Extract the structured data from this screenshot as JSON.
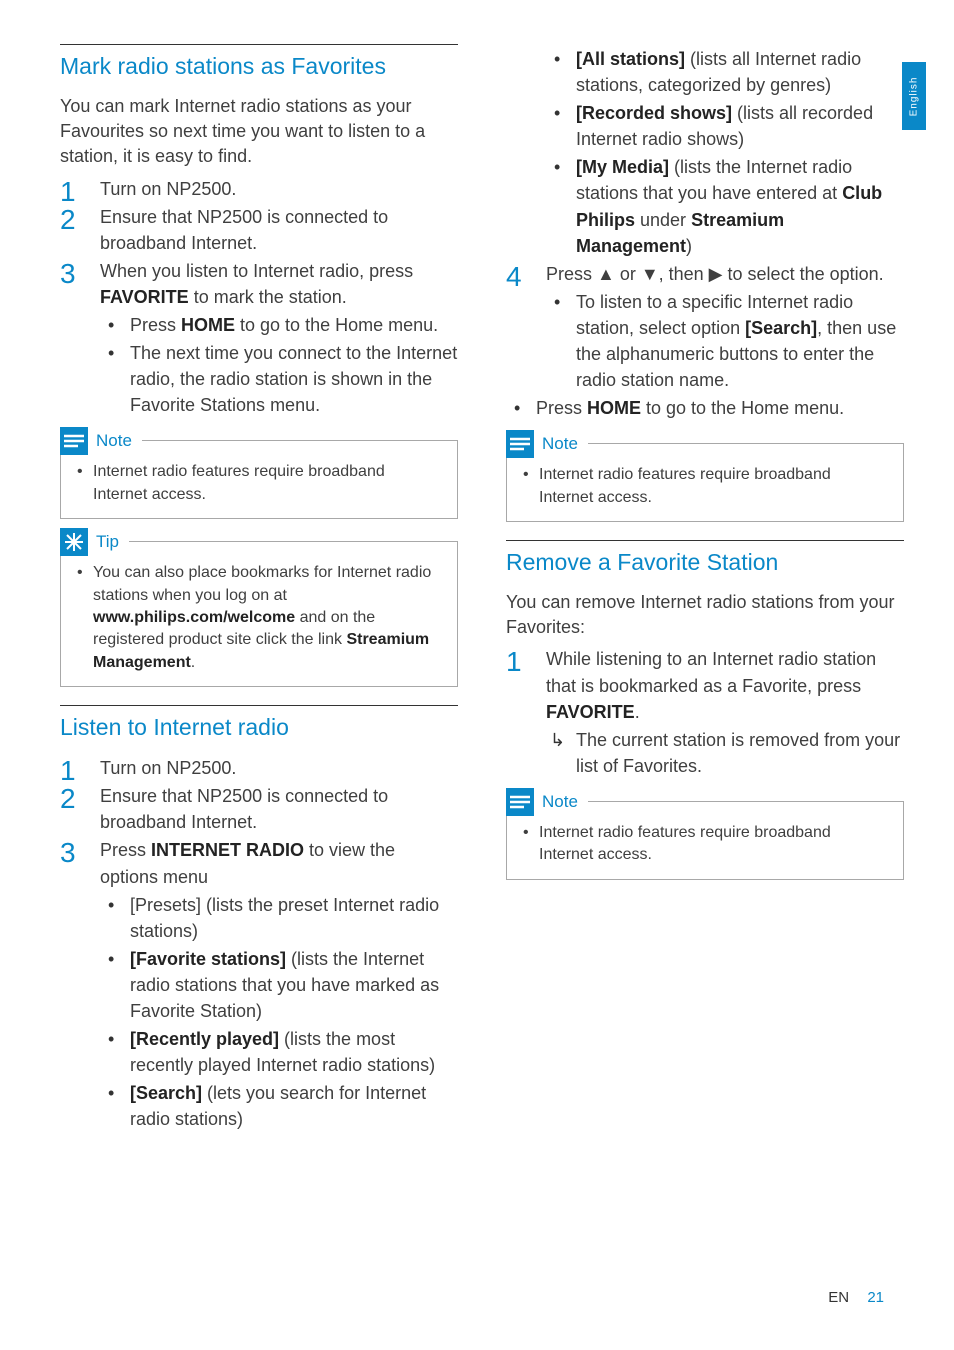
{
  "sideTab": "English",
  "footer": {
    "lang": "EN",
    "page": "21"
  },
  "labels": {
    "note": "Note",
    "tip": "Tip"
  },
  "left": {
    "sec1": {
      "title": "Mark radio stations as Favorites",
      "intro": "You can mark Internet radio stations as your Favourites so next time you want to listen to a station, it is easy to find.",
      "s1": "Turn on NP2500.",
      "s2": "Ensure that NP2500 is connected to broadband Internet.",
      "s3a": "When you listen to Internet radio, press ",
      "s3b": "FAVORITE",
      "s3c": " to mark the station.",
      "s3_b1a": "Press ",
      "s3_b1b": "HOME",
      "s3_b1c": " to go to the Home menu.",
      "s3_b2": "The next time you connect to the Internet radio, the radio station is shown in the Favorite Stations menu.",
      "note": "Internet radio features require broadband Internet access.",
      "tip_a": "You can also place bookmarks for Internet radio stations when you log on at ",
      "tip_b": "www.philips.com/welcome",
      "tip_c": " and on the registered product site click the link ",
      "tip_d": "Streamium Management",
      "tip_e": "."
    },
    "sec2": {
      "title": "Listen to Internet radio",
      "s1": "Turn on NP2500.",
      "s2": "Ensure that NP2500 is connected to broadband Internet.",
      "s3a": "Press ",
      "s3b": "INTERNET RADIO",
      "s3c": " to view the options menu",
      "b1": "[Presets] (lists the preset Internet radio stations)",
      "b2a": "[Favorite stations]",
      "b2b": " (lists the Internet radio stations that you have marked as Favorite Station)",
      "b3a": "[Recently played]",
      "b3b": " (lists the most recently played Internet radio stations)",
      "b4a": "[Search]",
      "b4b": " (lets you search for Internet radio stations)"
    }
  },
  "right": {
    "cont": {
      "b5a": "[All stations]",
      "b5b": " (lists all Internet radio stations, categorized by genres)",
      "b6a": "[Recorded shows]",
      "b6b": " (lists all recorded Internet radio shows)",
      "b7a": "[My Media]",
      "b7b": " (lists the Internet radio stations that you have entered at ",
      "b7c": "Club Philips",
      "b7d": " under ",
      "b7e": "Streamium Management",
      "b7f": ")",
      "s4": "Press ▲ or ▼, then ▶ to select the option.",
      "s4_b1a": "To listen to a specific Internet radio station, select option ",
      "s4_b1b": "[Search]",
      "s4_b1c": ", then use the alphanumeric buttons to enter the radio station name.",
      "home_a": "Press ",
      "home_b": "HOME",
      "home_c": " to go to the Home menu.",
      "note": "Internet radio features require broadband Internet access."
    },
    "sec3": {
      "title": "Remove a Favorite Station",
      "intro": "You can remove Internet radio stations from your Favorites:",
      "s1a": "While listening to an Internet radio station that is bookmarked as a Favorite, press ",
      "s1b": "FAVORITE",
      "s1c": ".",
      "s1_r": "The current station is removed from your list of Favorites.",
      "note": "Internet radio features require broadband Internet access."
    }
  }
}
